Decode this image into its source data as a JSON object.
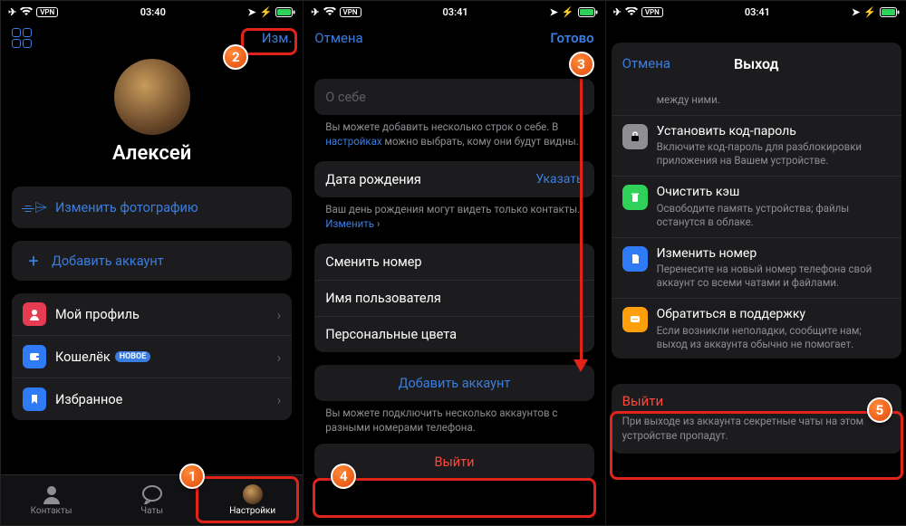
{
  "status": {
    "time1": "03:40",
    "time2": "03:41",
    "time3": "03:41",
    "vpn": "VPN"
  },
  "s1": {
    "edit": "Изм.",
    "name": "Алексей",
    "change_photo": "Изменить фотографию",
    "add_account": "Добавить аккаунт",
    "my_profile": "Мой профиль",
    "wallet": "Кошелёк",
    "wallet_badge": "НОВОЕ",
    "favorites": "Избранное",
    "tabs": {
      "contacts": "Контакты",
      "chats": "Чаты",
      "settings": "Настройки"
    }
  },
  "s2": {
    "cancel": "Отмена",
    "done": "Готово",
    "about_placeholder": "О себе",
    "about_note_a": "Вы можете добавить несколько строк о себе. В ",
    "about_note_link": "настройках",
    "about_note_b": " можно выбрать, кому они будут видны.",
    "dob": "Дата рождения",
    "dob_action": "Указать",
    "dob_note_a": "Ваш день рождения могут видеть только контакты. ",
    "dob_note_link": "Изменить",
    "change_number": "Сменить номер",
    "username": "Имя пользователя",
    "colors": "Персональные цвета",
    "add_account": "Добавить аккаунт",
    "add_note": "Вы можете подключить несколько аккаунтов с разными номерами телефона.",
    "logout": "Выйти"
  },
  "s3": {
    "cancel": "Отмена",
    "title": "Выход",
    "between": "между ними.",
    "passcode_t": "Установить код-пароль",
    "passcode_s": "Включите код-пароль для разблокировки приложения на Вашем устройстве.",
    "cache_t": "Очистить кэш",
    "cache_s": "Освободите память устройства; файлы останутся в облаке.",
    "number_t": "Изменить номер",
    "number_s": "Перенесите на новый номер телефона свой аккаунт со всеми чатами и файлами.",
    "support_t": "Обратиться в поддержку",
    "support_s": "Если возникли неполадки, сообщите нам; выход из аккаунта обычно не помогает.",
    "logout": "Выйти",
    "logout_s": "При выходе из аккаунта секретные чаты на этом устройстве пропадут."
  },
  "callouts": {
    "c1": "1",
    "c2": "2",
    "c3": "3",
    "c4": "4",
    "c5": "5"
  }
}
